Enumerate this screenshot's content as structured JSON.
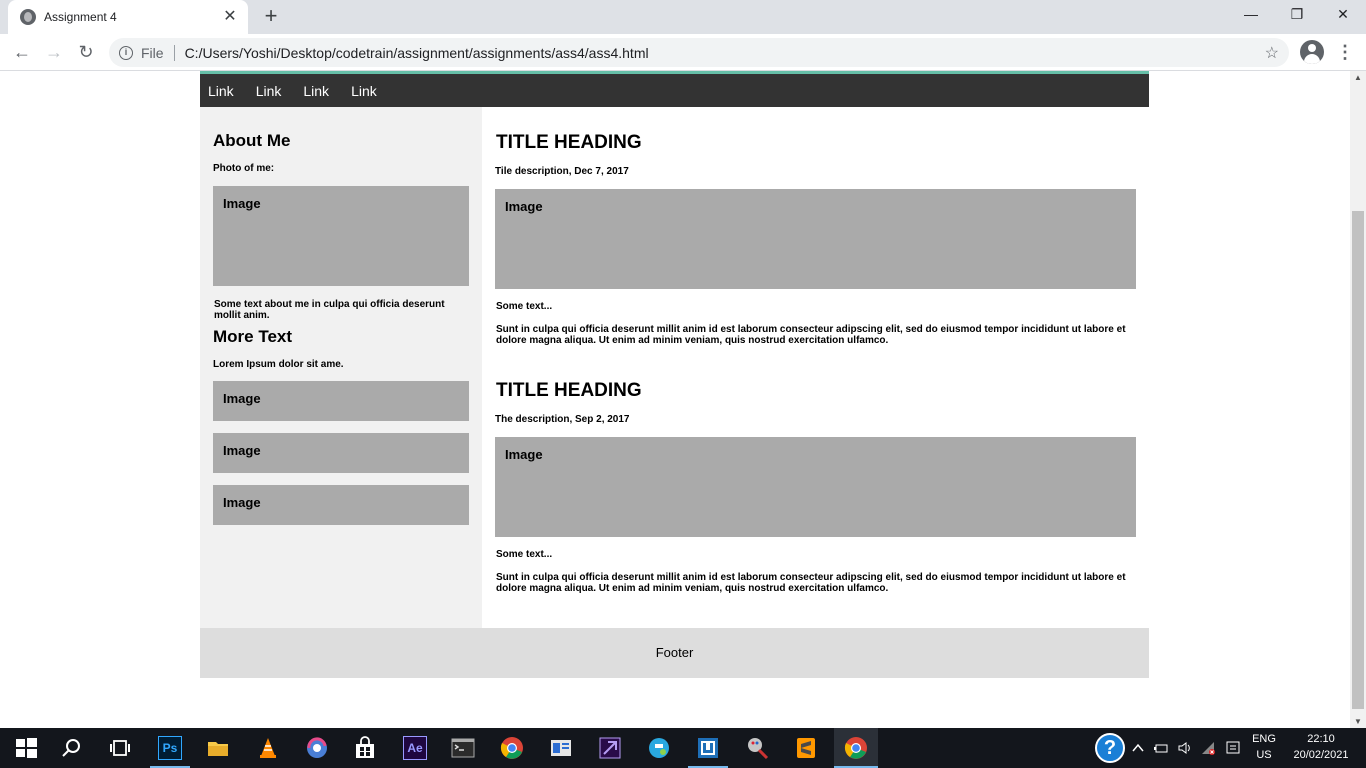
{
  "browser": {
    "tab_title": "Assignment 4",
    "tab_close": "✕",
    "new_tab": "+",
    "minimize": "—",
    "restore": "❐",
    "close": "✕",
    "back": "←",
    "forward": "→",
    "reload": "↻",
    "info": "i",
    "file_label": "File",
    "url": "C:/Users/Yoshi/Desktop/codetrain/assignment/assignments/ass4/ass4.html",
    "star": "☆",
    "menu": "⋮"
  },
  "page": {
    "nav_links": [
      "Link",
      "Link",
      "Link",
      "Link"
    ],
    "sidebar": {
      "about_heading": "About Me",
      "photo_label": "Photo of me:",
      "photo_image": "Image",
      "about_text": "Some text about me in culpa qui officia deserunt mollit anim.",
      "more_heading": "More Text",
      "more_text": "Lorem Ipsum dolor sit ame.",
      "images": [
        "Image",
        "Image",
        "Image"
      ]
    },
    "articles": [
      {
        "title": "TITLE HEADING",
        "description": "Tile description, Dec 7, 2017",
        "image": "Image",
        "some_text": "Some text...",
        "body": "Sunt in culpa qui officia deserunt millit anim id est laborum consecteur adipscing elit, sed do eiusmod tempor incididunt ut labore et dolore magna aliqua. Ut enim ad minim veniam, quis nostrud exercitation ulfamco."
      },
      {
        "title": "TITLE HEADING",
        "description": "The description, Sep 2, 2017",
        "image": "Image",
        "some_text": "Some text...",
        "body": "Sunt in culpa qui officia deserunt millit anim id est laborum consecteur adipscing elit, sed do eiusmod tempor incididunt ut labore et dolore magna aliqua. Ut enim ad minim veniam, quis nostrud exercitation ulfamco."
      }
    ],
    "footer": "Footer"
  },
  "taskbar": {
    "icons": [
      "windows-start",
      "search",
      "task-view",
      "photoshop",
      "file-explorer",
      "vlc",
      "browser-swirl",
      "store",
      "after-effects",
      "terminal",
      "chrome",
      "app-blue",
      "premiere",
      "app-globe",
      "app-box",
      "paint-tool",
      "sublime-text",
      "chrome-active"
    ],
    "photoshop_label": "Ps",
    "aftereffects_label": "Ae",
    "help_label": "?",
    "language": "ENG",
    "region": "US",
    "time": "22:10",
    "date": "20/02/2021"
  },
  "colors": {
    "nav_bg": "#333333",
    "nav_accent": "#66bfa8",
    "sidebar_bg": "#f1f1f1",
    "image_placeholder": "#aaaaaa",
    "footer_bg": "#dddddd",
    "taskbar_bg": "#13161c"
  }
}
